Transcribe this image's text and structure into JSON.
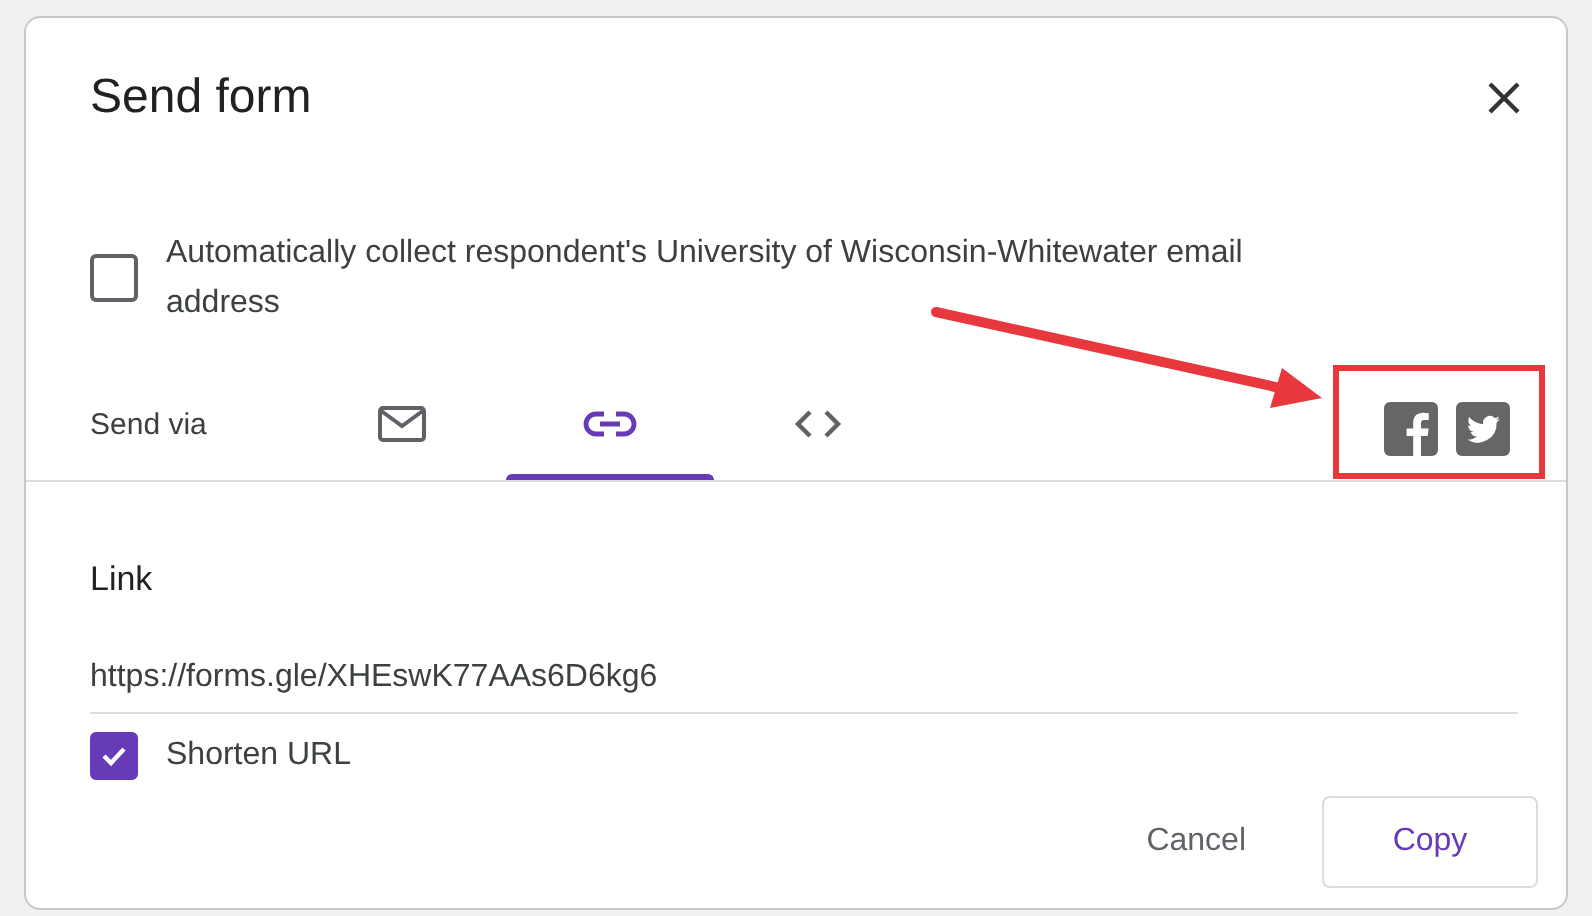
{
  "dialog": {
    "title": "Send form"
  },
  "collect_email": {
    "label": "Automatically collect respondent's University of Wisconsin-Whitewater email address",
    "checked": false
  },
  "send_via": {
    "label": "Send via",
    "tabs": [
      {
        "kind": "email",
        "selected": false
      },
      {
        "kind": "link",
        "selected": true
      },
      {
        "kind": "embed",
        "selected": false
      }
    ],
    "share": [
      {
        "kind": "facebook"
      },
      {
        "kind": "twitter"
      }
    ]
  },
  "link": {
    "heading": "Link",
    "url": "https://forms.gle/XHEswK77AAs6D6kg6",
    "shorten": {
      "label": "Shorten URL",
      "checked": true
    }
  },
  "buttons": [
    {
      "kind": "text",
      "label": "Cancel"
    },
    {
      "kind": "outlined",
      "label": "Copy"
    }
  ],
  "callout": {
    "arrow": true,
    "box": true
  }
}
